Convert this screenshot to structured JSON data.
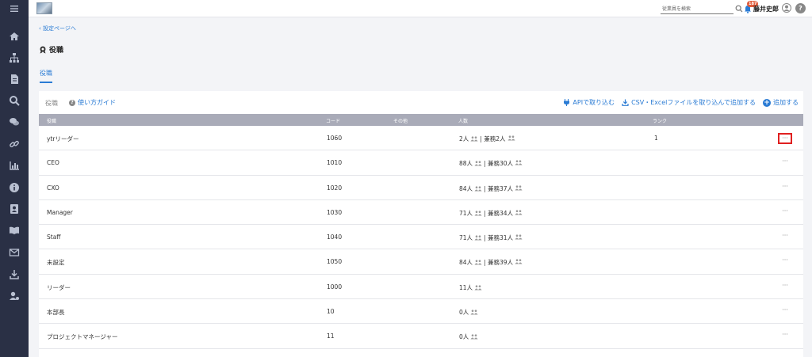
{
  "header": {
    "search_placeholder": "従業員を検索",
    "notification_count": "187",
    "user_name": "藤井史郎",
    "help_label": "?"
  },
  "nav": {
    "back_label": "設定ページへ",
    "page_title": "役職",
    "tab_label": "役職"
  },
  "toolbar": {
    "panel_label": "役職",
    "guide_label": "使い方ガイド",
    "guide_icon": "?",
    "api_label": "APIで取り込む",
    "csv_label": "CSV・Excelファイルを取り込んで追加する",
    "add_label": "追加する",
    "add_icon": "+"
  },
  "table": {
    "columns": [
      "役職",
      "コード",
      "その他",
      "人数",
      "ランク"
    ],
    "more_label": "···",
    "rows": [
      {
        "role": "ytrリーダー",
        "code": "1060",
        "count": "2人",
        "concurrent": "兼務2人",
        "rank": "1"
      },
      {
        "role": "CEO",
        "code": "1010",
        "count": "88人",
        "concurrent": "兼務30人",
        "rank": ""
      },
      {
        "role": "CXO",
        "code": "1020",
        "count": "84人",
        "concurrent": "兼務37人",
        "rank": ""
      },
      {
        "role": "Manager",
        "code": "1030",
        "count": "71人",
        "concurrent": "兼務34人",
        "rank": ""
      },
      {
        "role": "Staff",
        "code": "1040",
        "count": "71人",
        "concurrent": "兼務31人",
        "rank": ""
      },
      {
        "role": "未設定",
        "code": "1050",
        "count": "84人",
        "concurrent": "兼務39人",
        "rank": ""
      },
      {
        "role": "リーダー",
        "code": "1000",
        "count": "11人",
        "concurrent": "",
        "rank": ""
      },
      {
        "role": "本部長",
        "code": "10",
        "count": "0人",
        "concurrent": "",
        "rank": ""
      },
      {
        "role": "プロジェクトマネージャー",
        "code": "11",
        "count": "0人",
        "concurrent": "",
        "rank": ""
      }
    ]
  },
  "sidebar": {
    "icons": [
      "menu-icon",
      "home-icon",
      "org-chart-icon",
      "document-icon",
      "search-icon",
      "chat-icon",
      "link-icon",
      "chart-icon",
      "info-icon",
      "contact-card-icon",
      "book-icon",
      "mail-icon",
      "download-icon",
      "user-settings-icon"
    ]
  },
  "colors": {
    "accent": "#2a7bd4",
    "sidebar": "#2a3045",
    "table_header": "#a9abb8",
    "badge": "#e05b3a",
    "highlight": "#e02020"
  }
}
